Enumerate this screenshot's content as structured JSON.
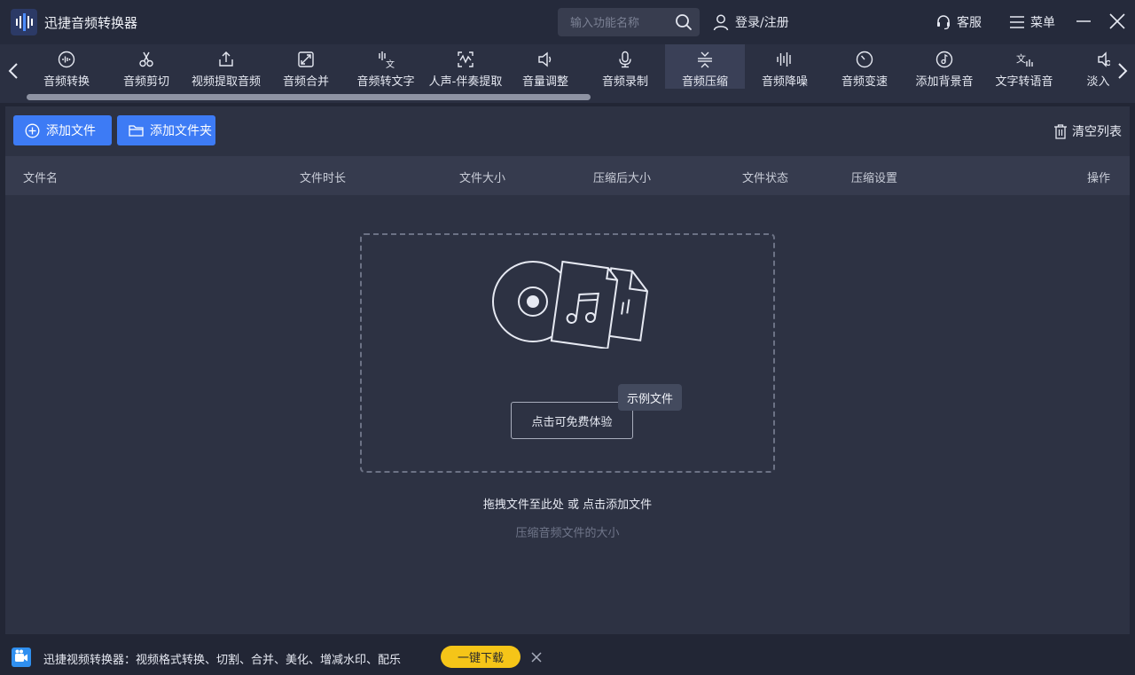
{
  "app": {
    "title": "迅捷音频转换器"
  },
  "search": {
    "placeholder": "输入功能名称"
  },
  "header": {
    "login": "登录/注册",
    "service": "客服",
    "menu": "菜单"
  },
  "tools": [
    {
      "label": "音频转换",
      "icon": "waveform-circle-icon"
    },
    {
      "label": "音频剪切",
      "icon": "scissors-icon"
    },
    {
      "label": "视频提取音频",
      "icon": "upload-share-icon"
    },
    {
      "label": "音频合并",
      "icon": "merge-expand-icon"
    },
    {
      "label": "音频转文字",
      "icon": "voice-to-text-icon"
    },
    {
      "label": "人声-伴奏提取",
      "icon": "vocal-extract-icon"
    },
    {
      "label": "音量调整",
      "icon": "volume-icon"
    },
    {
      "label": "音频录制",
      "icon": "microphone-icon"
    },
    {
      "label": "音频压缩",
      "icon": "compress-icon",
      "active": true
    },
    {
      "label": "音频降噪",
      "icon": "equalizer-icon"
    },
    {
      "label": "音频变速",
      "icon": "speed-dial-icon"
    },
    {
      "label": "添加背景音",
      "icon": "music-note-circle-icon"
    },
    {
      "label": "文字转语音",
      "icon": "text-to-speech-icon"
    },
    {
      "label": "淡入淡",
      "icon": "fade-icon"
    }
  ],
  "actions": {
    "add_file": "添加文件",
    "add_folder": "添加文件夹",
    "clear_list": "清空列表"
  },
  "table": {
    "columns": [
      "文件名",
      "文件时长",
      "文件大小",
      "压缩后大小",
      "文件状态",
      "压缩设置",
      "操作"
    ]
  },
  "dropzone": {
    "trial_button": "点击可免费体验",
    "sample_tag": "示例文件",
    "hint": "拖拽文件至此处 或 点击添加文件",
    "subhint": "压缩音频文件的大小"
  },
  "ad": {
    "text": "迅捷视频转换器：视频格式转换、切割、合并、美化、增减水印、配乐",
    "button": "一键下载"
  },
  "colors": {
    "accent": "#3d7bf5",
    "ad_button": "#f5c518",
    "active_tool": "#3a4057"
  }
}
